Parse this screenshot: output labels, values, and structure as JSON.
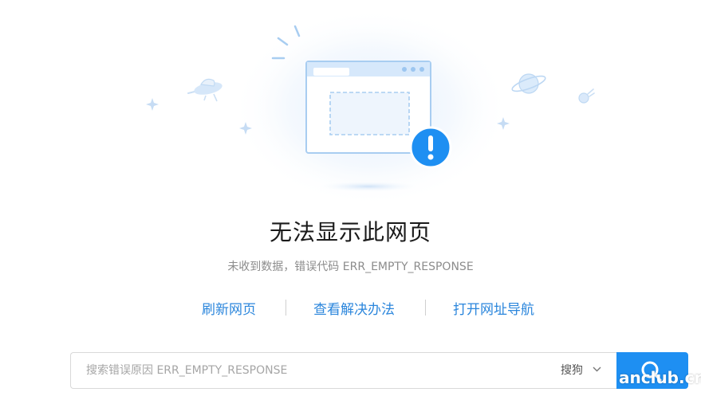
{
  "error": {
    "title": "无法显示此网页",
    "subtitle": "未收到数据，错误代码 ERR_EMPTY_RESPONSE"
  },
  "actions": [
    {
      "label": "刷新网页"
    },
    {
      "label": "查看解决办法"
    },
    {
      "label": "打开网址导航"
    }
  ],
  "search": {
    "placeholder": "搜索错误原因 ERR_EMPTY_RESPONSE",
    "engine": "搜狗",
    "button_icon": "search-icon",
    "accent_color": "#1e8ff2"
  },
  "watermark": {
    "text": "anclub.cn"
  },
  "icons": {
    "illustration": "browser-window-error-icon",
    "alert": "exclamation-icon",
    "ufo": "ufo-icon",
    "planet": "planet-icon",
    "comet": "comet-icon"
  }
}
